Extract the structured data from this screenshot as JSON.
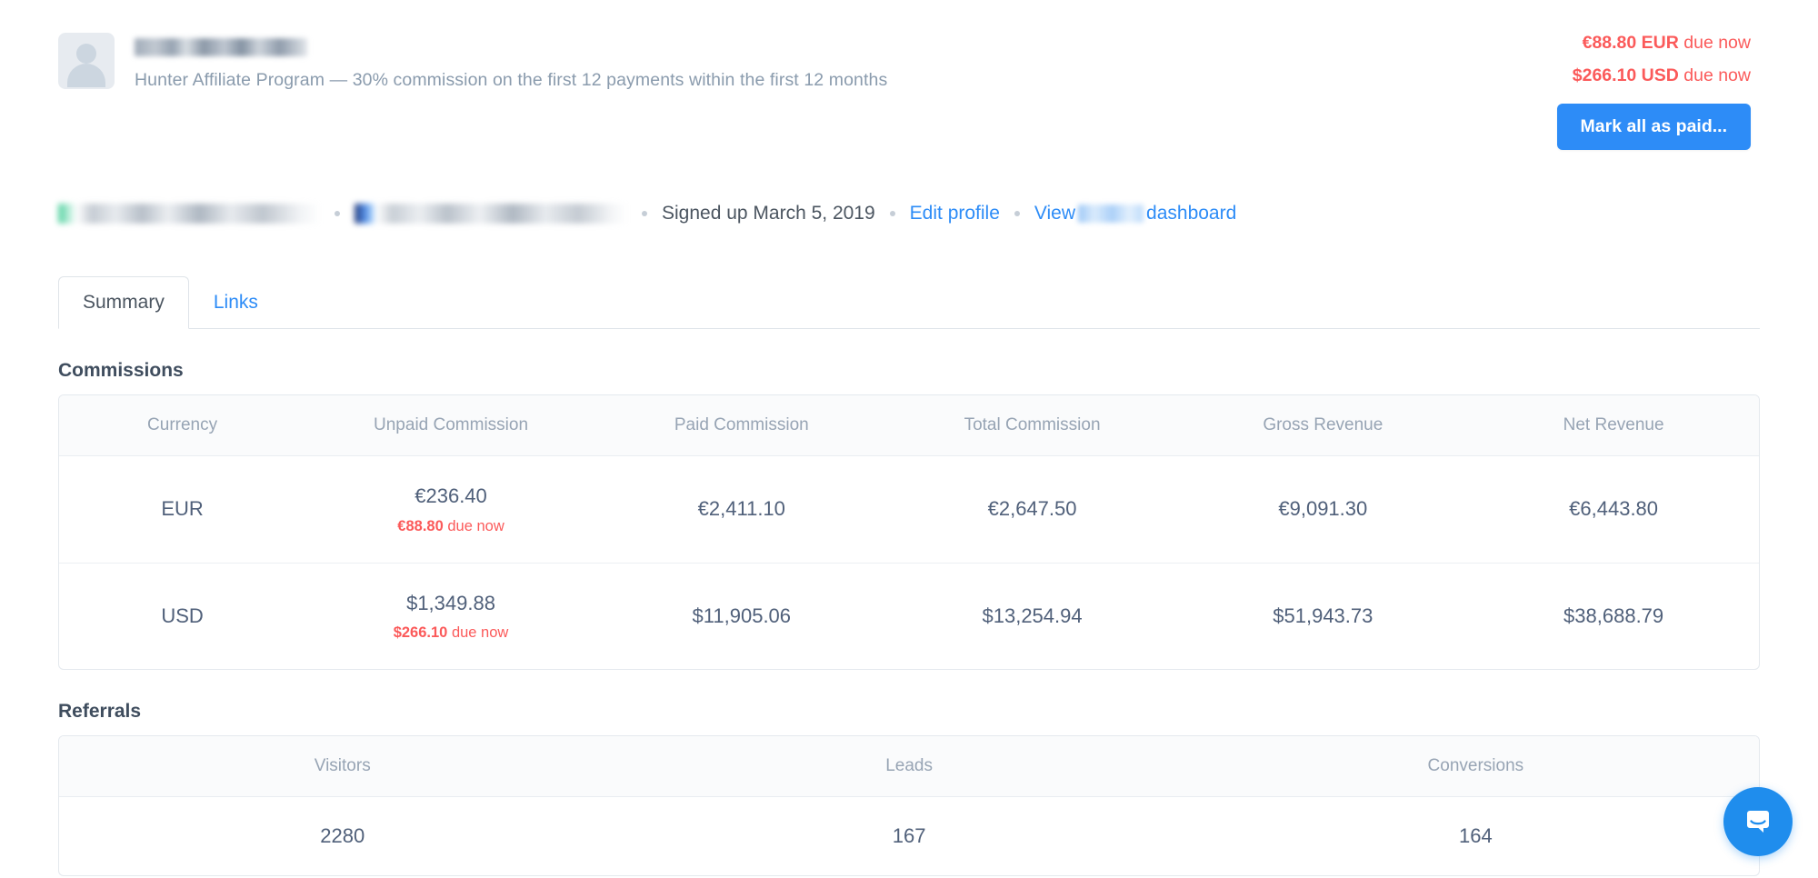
{
  "header": {
    "avatar_icon": "user-avatar-placeholder",
    "affiliate_name_redacted": "",
    "program_description": "Hunter Affiliate Program — 30% commission on the first 12 payments within the first 12 months",
    "due_now": [
      {
        "amount": "€88.80 EUR",
        "suffix": " due now"
      },
      {
        "amount": "$266.10 USD",
        "suffix": " due now"
      }
    ],
    "mark_all_paid_label": "Mark all as paid...",
    "accent_color": "#2d8cf7",
    "danger_color": "#fb5a5a"
  },
  "meta": {
    "email_redacted": "",
    "website_redacted": "",
    "signup_text": "Signed up March 5, 2019",
    "edit_profile_label": "Edit profile",
    "view_dashboard_prefix": "View",
    "view_dashboard_suffix": "dashboard"
  },
  "tabs": [
    {
      "label": "Summary",
      "active": true
    },
    {
      "label": "Links",
      "active": false
    }
  ],
  "commissions": {
    "title": "Commissions",
    "columns": [
      "Currency",
      "Unpaid Commission",
      "Paid Commission",
      "Total Commission",
      "Gross Revenue",
      "Net Revenue"
    ],
    "rows": [
      {
        "currency": "EUR",
        "unpaid": "€236.40",
        "due_amount": "€88.80",
        "due_suffix": " due now",
        "paid": "€2,411.10",
        "total": "€2,647.50",
        "gross": "€9,091.30",
        "net": "€6,443.80"
      },
      {
        "currency": "USD",
        "unpaid": "$1,349.88",
        "due_amount": "$266.10",
        "due_suffix": " due now",
        "paid": "$11,905.06",
        "total": "$13,254.94",
        "gross": "$51,943.73",
        "net": "$38,688.79"
      }
    ]
  },
  "referrals": {
    "title": "Referrals",
    "columns": [
      "Visitors",
      "Leads",
      "Conversions"
    ],
    "rows": [
      {
        "visitors": "2280",
        "leads": "167",
        "conversions": "164"
      }
    ]
  },
  "chat": {
    "icon": "intercom-chat-icon",
    "color": "#1f8ded"
  }
}
